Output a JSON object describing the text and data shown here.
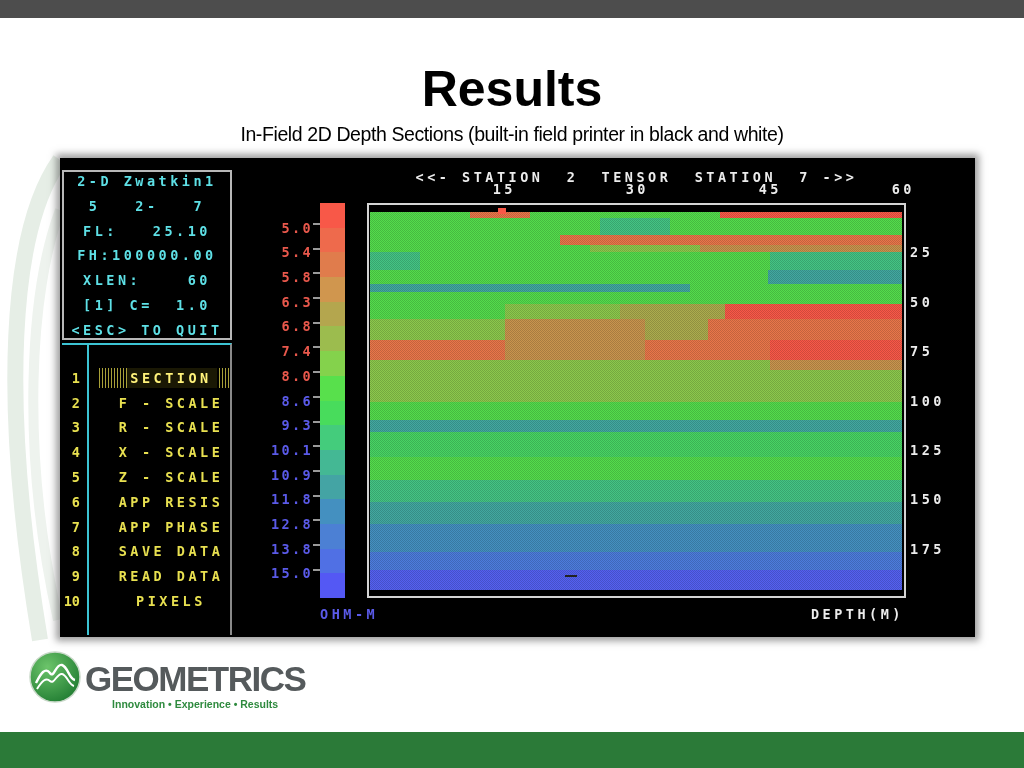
{
  "slide": {
    "title": "Results",
    "subtitle": "In-Field 2D Depth Sections (built-in field printer in black and white)"
  },
  "screen": {
    "info_panel": [
      "2-D Zwatkin1",
      "5   2-   7",
      "FL:   25.10",
      "FH:100000.00",
      "XLEN:    60",
      "[1] C=  1.0",
      "<ESC> TO QUIT"
    ],
    "menu": [
      {
        "number": "1",
        "label": "SECTION",
        "selected": true
      },
      {
        "number": "2",
        "label": "F - SCALE",
        "selected": false
      },
      {
        "number": "3",
        "label": "R - SCALE",
        "selected": false
      },
      {
        "number": "4",
        "label": "X - SCALE",
        "selected": false
      },
      {
        "number": "5",
        "label": "Z - SCALE",
        "selected": false
      },
      {
        "number": "6",
        "label": "APP RESIS",
        "selected": false
      },
      {
        "number": "7",
        "label": "APP PHASE",
        "selected": false
      },
      {
        "number": "8",
        "label": "SAVE DATA",
        "selected": false
      },
      {
        "number": "9",
        "label": "READ DATA",
        "selected": false
      },
      {
        "number": "10",
        "label": "PIXELS",
        "selected": false
      }
    ],
    "color_scale": {
      "bands": [
        {
          "color": "#f85848"
        },
        {
          "color": "#ee6a4c"
        },
        {
          "color": "#e07c4c"
        },
        {
          "color": "#d0964e"
        },
        {
          "color": "#b4a64e"
        },
        {
          "color": "#9cbc4e"
        },
        {
          "color": "#84d24c"
        },
        {
          "color": "#58e04c"
        },
        {
          "color": "#48dc5c"
        },
        {
          "color": "#44cc7c"
        },
        {
          "color": "#44b894"
        },
        {
          "color": "#44a4a4"
        },
        {
          "color": "#4490c0"
        },
        {
          "color": "#4c80d4"
        },
        {
          "color": "#5070e4"
        },
        {
          "color": "#5458f4"
        }
      ],
      "labels": [
        {
          "text": "5.0",
          "color": "#e8584c"
        },
        {
          "text": "5.4",
          "color": "#e8584c"
        },
        {
          "text": "5.8",
          "color": "#e8584c"
        },
        {
          "text": "6.3",
          "color": "#e8584c"
        },
        {
          "text": "6.8",
          "color": "#e8584c"
        },
        {
          "text": "7.4",
          "color": "#e8584c"
        },
        {
          "text": "8.0",
          "color": "#e8584c"
        },
        {
          "text": "8.6",
          "color": "#5a5ae8"
        },
        {
          "text": "9.3",
          "color": "#5a5ae8"
        },
        {
          "text": "10.1",
          "color": "#5a5ae8"
        },
        {
          "text": "10.9",
          "color": "#5a5ae8"
        },
        {
          "text": "11.8",
          "color": "#5a5ae8"
        },
        {
          "text": "12.8",
          "color": "#5a5ae8"
        },
        {
          "text": "13.8",
          "color": "#5a5ae8"
        },
        {
          "text": "15.0",
          "color": "#5a5ae8"
        }
      ],
      "unit": "OHM-M"
    },
    "section": {
      "header": "<<- STATION  2  TENSOR  STATION  7 ->>",
      "station_ticks": [
        "15",
        "30",
        "45",
        "60"
      ],
      "depth_ticks": [
        "25",
        "50",
        "75",
        "100",
        "125",
        "150",
        "175"
      ],
      "depth_label": "DEPTH(M)"
    }
  },
  "logo": {
    "wordmark": "GEOMETRICS",
    "tagline": "Innovation • Experience • Results"
  }
}
